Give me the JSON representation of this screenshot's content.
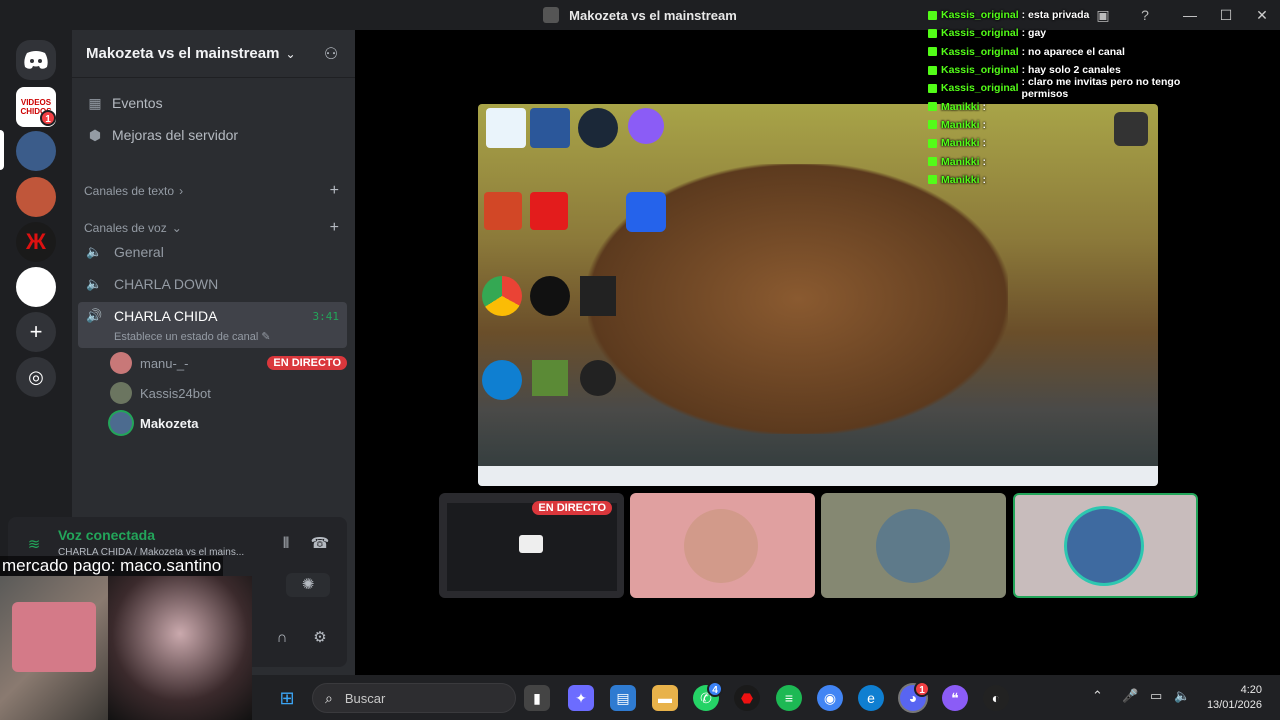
{
  "window": {
    "title": "Makozeta vs el mainstream"
  },
  "server": {
    "name": "Makozeta vs el mainstream"
  },
  "menu": [
    {
      "label": "Eventos",
      "icon": "calendar-icon"
    },
    {
      "label": "Mejoras del servidor",
      "icon": "boost-icon"
    }
  ],
  "categories": {
    "text": "Canales de texto",
    "voice": "Canales de voz"
  },
  "voice_channels": [
    {
      "name": "General"
    },
    {
      "name": "CHARLA DOWN"
    },
    {
      "name": "CHARLA CHIDA",
      "timer": "3:41",
      "status": "Establece un estado de canal"
    }
  ],
  "voice_users": [
    {
      "name": "manu-_-",
      "live": "EN DIRECTO"
    },
    {
      "name": "Kassis24bot"
    },
    {
      "name": "Makozeta"
    }
  ],
  "server_badges": {
    "videos_chidos": "1"
  },
  "server_tiles": {
    "videos_chidos_text": "VIDEOS CHIDOS"
  },
  "voice_panel": {
    "title": "Voz conectada",
    "subtitle": "CHARLA CHIDA / Makozeta vs el mains..."
  },
  "overlay_text": "mercado pago: maco.santino",
  "tiles": {
    "live_label": "EN DIRECTO"
  },
  "chat": [
    {
      "user": "Kassis_original",
      "msg": ": esta privada"
    },
    {
      "user": "Kassis_original",
      "msg": ": gay"
    },
    {
      "user": "Kassis_original",
      "msg": ": no aparece el canal"
    },
    {
      "user": "Kassis_original",
      "msg": ": hay solo 2 canales"
    },
    {
      "user": "Kassis_original",
      "msg": ": claro me invitas pero no tengo permisos"
    },
    {
      "user": "Manikki",
      "msg": ":"
    },
    {
      "user": "Manikki",
      "msg": ":"
    },
    {
      "user": "Manikki",
      "msg": ":"
    },
    {
      "user": "Manikki",
      "msg": ":"
    },
    {
      "user": "Manikki",
      "msg": ":"
    }
  ],
  "taskbar": {
    "search_placeholder": "Buscar",
    "time": "4:20",
    "date": "13/01/2026",
    "whatsapp_badge": "4",
    "discord_badge": "1"
  },
  "colors": {
    "accent_green": "#23a55a",
    "live_red": "#da373c",
    "sidebar_bg": "#2b2d31",
    "rail_bg": "#1e1f22"
  }
}
